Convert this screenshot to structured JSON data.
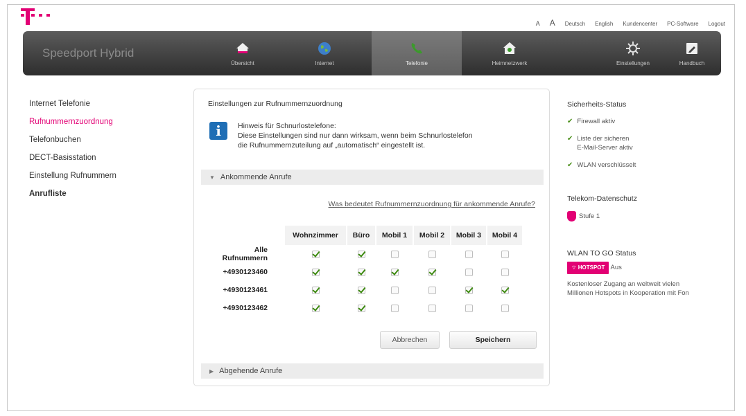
{
  "top_links": {
    "font_small": "A",
    "font_large": "A",
    "lang_de": "Deutsch",
    "lang_en": "English",
    "customer_center": "Kundencenter",
    "pc_software": "PC-Software",
    "logout": "Logout"
  },
  "brand": "Speedport Hybrid",
  "nav": {
    "items": [
      {
        "label": "Übersicht",
        "icon": "home-icon"
      },
      {
        "label": "Internet",
        "icon": "globe-icon"
      },
      {
        "label": "Telefonie",
        "icon": "phone-icon"
      },
      {
        "label": "Heimnetzwerk",
        "icon": "house-network-icon"
      },
      {
        "label": "Einstellungen",
        "icon": "gear-icon"
      },
      {
        "label": "Handbuch",
        "icon": "manual-icon"
      }
    ],
    "active": "Telefonie"
  },
  "sidebar": {
    "items": [
      {
        "label": "Internet Telefonie"
      },
      {
        "label": "Rufnummernzuordnung"
      },
      {
        "label": "Telefonbuchen"
      },
      {
        "label": "DECT-Basisstation"
      },
      {
        "label": "Einstellung Rufnummern"
      },
      {
        "label": "Anrufliste"
      }
    ],
    "active": "Rufnummernzuordnung"
  },
  "main": {
    "title": "Einstellungen zur Rufnummernzuordnung",
    "hint": {
      "title": "Hinweis für Schnurlostelefone:",
      "line1": "Diese Einstellungen sind nur dann wirksam, wenn beim Schnurlostelefon",
      "line2": "die Rufnummernzuteilung auf „automatisch“ eingestellt ist."
    },
    "incoming_section": "Ankommende Anrufe",
    "help_link": "Was bedeutet Rufnummernzuordnung für ankommende Anrufe?",
    "columns": [
      "Wohnzimmer",
      "Büro",
      "Mobil 1",
      "Mobil 2",
      "Mobil 3",
      "Mobil 4"
    ],
    "rows": [
      {
        "number": "Alle Rufnummern",
        "checks": [
          true,
          true,
          false,
          false,
          false,
          false
        ]
      },
      {
        "number": "+4930123460",
        "checks": [
          true,
          true,
          true,
          true,
          false,
          false
        ]
      },
      {
        "number": "+4930123461",
        "checks": [
          true,
          true,
          false,
          false,
          true,
          true
        ]
      },
      {
        "number": "+4930123462",
        "checks": [
          true,
          true,
          false,
          false,
          false,
          false
        ]
      }
    ],
    "cancel_label": "Abbrechen",
    "save_label": "Speichern",
    "outgoing_section": "Abgehende Anrufe"
  },
  "right": {
    "security_title": "Sicherheits-Status",
    "security_items": [
      {
        "line1": "Firewall aktiv",
        "line2": ""
      },
      {
        "line1": "Liste der sicheren",
        "line2": "E-Mail-Server aktiv"
      },
      {
        "line1": "WLAN verschlüsselt",
        "line2": ""
      }
    ],
    "privacy_title": "Telekom-Datenschutz",
    "privacy_level": "Stufe 1",
    "wlan_title": "WLAN TO GO Status",
    "hotspot_label": "HOTSPOT",
    "hotspot_state": "Aus",
    "hotspot_desc_1": "Kostenloser Zugang an weltweit vielen",
    "hotspot_desc_2": "Millionen Hotspots in Kooperation mit Fon"
  },
  "colors": {
    "brand_magenta": "#e20074",
    "check_green": "#3d8a10",
    "info_blue": "#1f6eb5"
  }
}
